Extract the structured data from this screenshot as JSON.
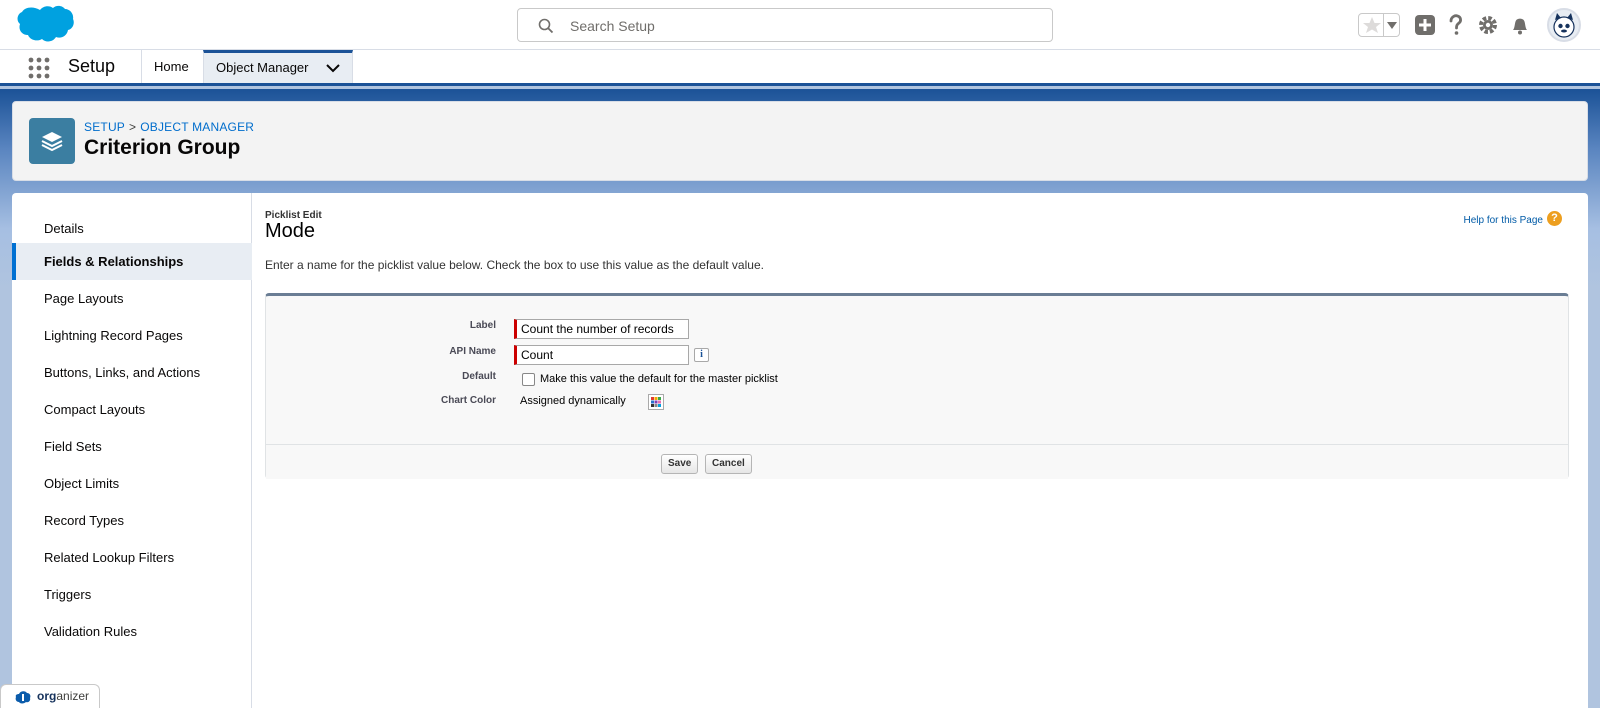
{
  "header": {
    "search_placeholder": "Search Setup",
    "brand_color": "#00a1e0"
  },
  "app_nav": {
    "app_name": "Setup",
    "tabs": [
      {
        "label": "Home"
      },
      {
        "label": "Object Manager"
      }
    ]
  },
  "object_header": {
    "breadcrumb": [
      "SETUP",
      "OBJECT MANAGER"
    ],
    "breadcrumb_separator": ">",
    "title": "Criterion Group"
  },
  "left_nav": {
    "items": [
      {
        "label": "Details"
      },
      {
        "label": "Fields & Relationships"
      },
      {
        "label": "Page Layouts"
      },
      {
        "label": "Lightning Record Pages"
      },
      {
        "label": "Buttons, Links, and Actions"
      },
      {
        "label": "Compact Layouts"
      },
      {
        "label": "Field Sets"
      },
      {
        "label": "Object Limits"
      },
      {
        "label": "Record Types"
      },
      {
        "label": "Related Lookup Filters"
      },
      {
        "label": "Triggers"
      },
      {
        "label": "Validation Rules"
      }
    ],
    "active": "Fields & Relationships"
  },
  "main": {
    "subtitle": "Picklist Edit",
    "title": "Mode",
    "help_link": "Help for this Page",
    "help_icon_glyph": "?",
    "instructions": "Enter a name for the picklist value below. Check the box to use this value as the default value.",
    "form": {
      "label_label": "Label",
      "label_value": "Count the number of records",
      "api_name_label": "API Name",
      "api_name_value": "Count",
      "info_glyph": "i",
      "default_label": "Default",
      "default_checked": false,
      "default_text": "Make this value the default for the master picklist",
      "chart_color_label": "Chart Color",
      "chart_color_value": "Assigned dynamically"
    },
    "buttons": {
      "save": "Save",
      "cancel": "Cancel"
    }
  },
  "organizer": {
    "bold": "org",
    "rest": "anizer"
  }
}
